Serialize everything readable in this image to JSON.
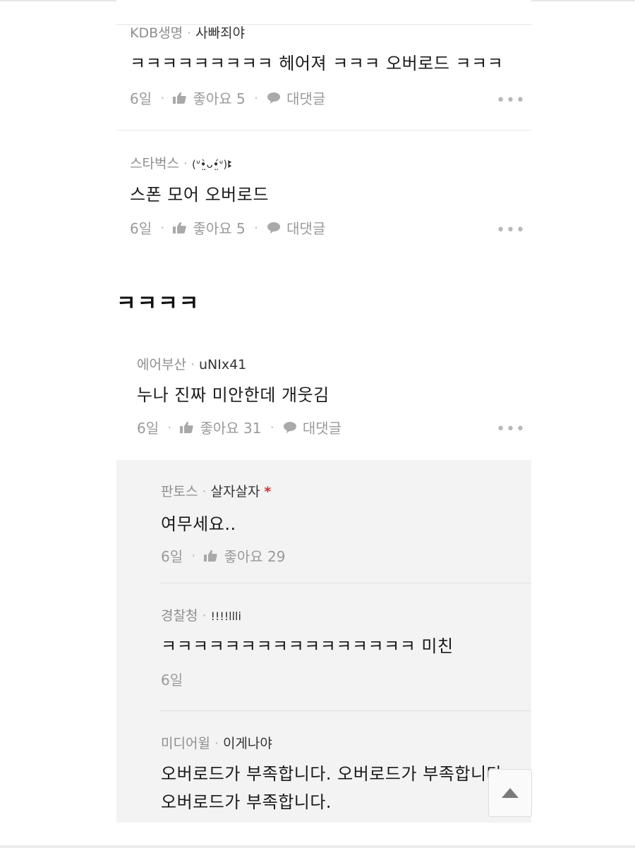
{
  "caption": "ㅋㅋㅋㅋ",
  "top_comments": [
    {
      "affiliation": "KDB생명",
      "nickname": "사빠죄야",
      "text": "ㅋㅋㅋㅋㅋㅋㅋㅋㅋ 헤어져 ㅋㅋㅋ 오버로드 ㅋㅋㅋ",
      "time": "6일",
      "like_label": "좋아요 5",
      "reply_label": "대댓글"
    },
    {
      "affiliation": "스타벅스",
      "nickname": "(ᐡ•̤̀ᴗ•̤́ᐡ)ꔪ",
      "text": "스폰 모어 오버로드",
      "time": "6일",
      "like_label": "좋아요 5",
      "reply_label": "대댓글"
    }
  ],
  "main_comment": {
    "affiliation": "에어부산",
    "nickname": "uNIx41",
    "text": "누나 진짜 미안한데 개웃김",
    "time": "6일",
    "like_label": "좋아요 31",
    "reply_label": "대댓글"
  },
  "replies": [
    {
      "affiliation": "판토스",
      "nickname": "살자살자",
      "author_mark": "*",
      "text": "여무세요..",
      "time": "6일",
      "like_label": "좋아요 29"
    },
    {
      "affiliation": "경찰청",
      "nickname": "!!!!llli",
      "text": "ㅋㅋㅋㅋㅋㅋㅋㅋㅋㅋㅋㅋㅋㅋㅋㅋ 미친",
      "time": "6일"
    },
    {
      "affiliation": "미디어윌",
      "nickname": "이게나야",
      "text_line1": "오버로드가 부족합니다. 오버로드가 부족합니다.",
      "text_line2": "오버로드가 부족합니다."
    }
  ],
  "more_label": "•••",
  "icons": {
    "like": "thumbs-up-icon",
    "reply": "speech-bubble-icon",
    "scroll_top": "triangle-up-icon"
  },
  "colors": {
    "meta_gray": "#8e8e8e",
    "reply_background": "#f3f3f3",
    "author_mark": "#d0302f"
  }
}
